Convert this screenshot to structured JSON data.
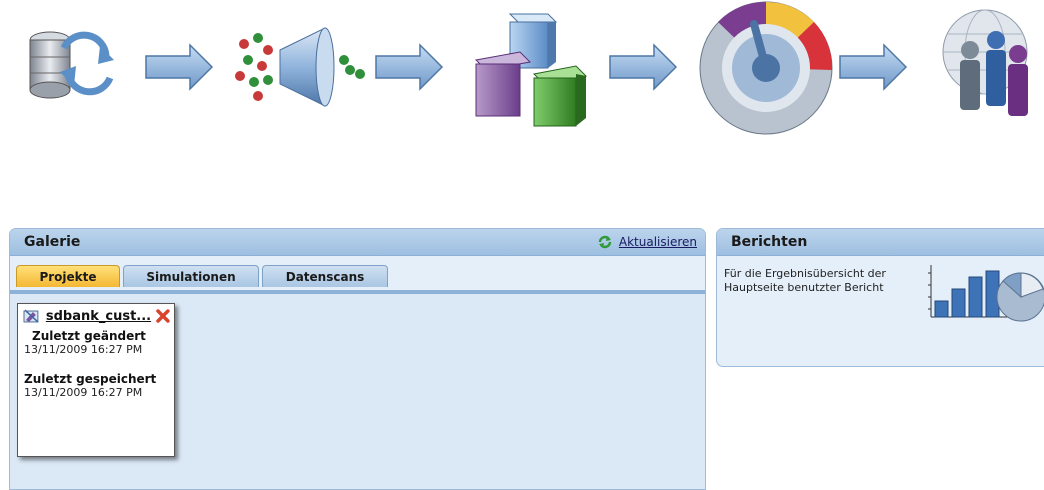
{
  "gallery": {
    "title": "Galerie",
    "refresh_label": "Aktualisieren",
    "tabs": [
      {
        "label": "Projekte",
        "active": true
      },
      {
        "label": "Simulationen",
        "active": false
      },
      {
        "label": "Datenscans",
        "active": false
      }
    ],
    "cards": [
      {
        "name": "sdbank_cust...",
        "modified_label": "Zuletzt geändert",
        "modified_value": "13/11/2009 16:27 PM",
        "saved_label": "Zuletzt gespeichert",
        "saved_value": "13/11/2009 16:27 PM"
      }
    ]
  },
  "reports": {
    "title": "Berichten",
    "description": "Für die Ergebnisübersicht der Hauptseite benutzter Bericht"
  },
  "colors": {
    "panel_bg": "#e4eff9",
    "header": "#a9c7e4",
    "active_tab": "#f4b833",
    "arrow": "#8fb3dd"
  },
  "workflow_icons": [
    "database-sync-icon",
    "data-filter-funnel-icon",
    "data-cubes-icon",
    "dashboard-gauge-icon",
    "people-globe-icon"
  ]
}
